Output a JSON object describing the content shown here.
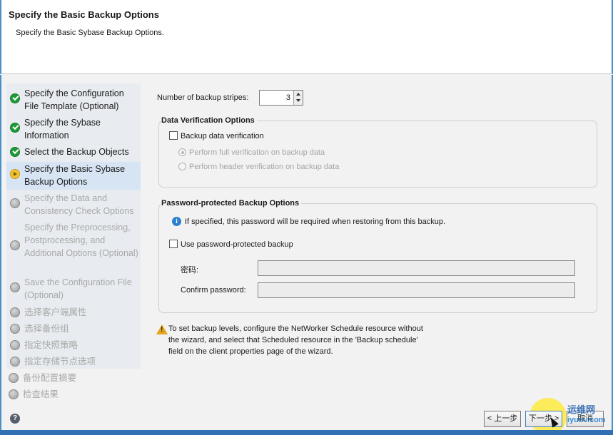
{
  "header": {
    "title": "Specify the Basic Backup Options",
    "subtitle": "Specify the Basic Sybase Backup Options."
  },
  "sidebar": {
    "steps": [
      {
        "label": "Specify the Configuration File Template (Optional)",
        "status": "done"
      },
      {
        "label": "Specify the Sybase Information",
        "status": "done"
      },
      {
        "label": "Select the Backup Objects",
        "status": "done"
      },
      {
        "label": "Specify the Basic Sybase Backup Options",
        "status": "current"
      },
      {
        "label": "Specify the Data and Consistency Check Options",
        "status": "future"
      },
      {
        "label": "Specify the Preprocessing, Postprocessing, and Additional Options (Optional)",
        "status": "future"
      },
      {
        "label": "Save the Configuration File (Optional)",
        "status": "future"
      },
      {
        "label": "选择客户端属性",
        "status": "future"
      },
      {
        "label": "选择备份组",
        "status": "future"
      },
      {
        "label": "指定快照策略",
        "status": "future"
      },
      {
        "label": "指定存储节点选项",
        "status": "future"
      },
      {
        "label": "备份配置摘要",
        "status": "future"
      },
      {
        "label": "检查结果",
        "status": "future"
      }
    ]
  },
  "main": {
    "stripes_label": "Number of backup stripes:",
    "stripes_value": "3",
    "verification": {
      "title": "Data Verification Options",
      "backup_verification_label": "Backup data verification",
      "backup_verification_checked": false,
      "full_verification_label": "Perform full verification on backup data",
      "header_verification_label": "Perform header verification on backup data"
    },
    "password": {
      "title": "Password-protected Backup Options",
      "info_text": "If specified, this password will be required when restoring from this backup.",
      "use_password_label": "Use password-protected backup",
      "use_password_checked": false,
      "password_label": "密码:",
      "confirm_label": "Confirm password:"
    },
    "note": "To set backup levels, configure the NetWorker Schedule resource without the wizard, and select that Scheduled resource in the 'Backup schedule' field on the client properties page of the wizard."
  },
  "footer": {
    "back_label": "< 上一步",
    "next_label": "下一步 >",
    "cancel_label": "取消"
  },
  "watermark": {
    "line1": "运维网",
    "line2": "iyunv.com"
  },
  "colors": {
    "accent": "#2f6fb2",
    "check": "#1f9a3a",
    "current": "#f2c231"
  },
  "icons": [
    "check-icon",
    "arrow-icon",
    "pending-icon",
    "info-icon",
    "warning-icon",
    "help-icon",
    "spinner-up-icon",
    "spinner-down-icon"
  ]
}
